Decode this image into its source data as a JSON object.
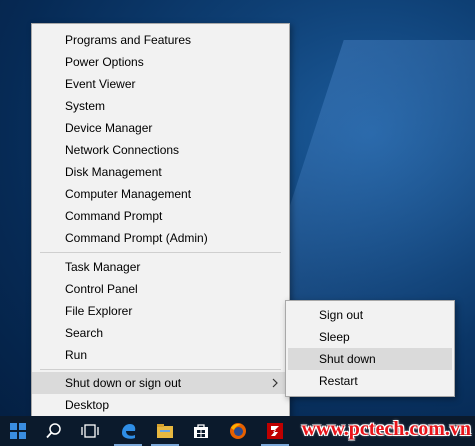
{
  "menu": {
    "group1": [
      "Programs and Features",
      "Power Options",
      "Event Viewer",
      "System",
      "Device Manager",
      "Network Connections",
      "Disk Management",
      "Computer Management",
      "Command Prompt",
      "Command Prompt (Admin)"
    ],
    "group2": [
      "Task Manager",
      "Control Panel",
      "File Explorer",
      "Search",
      "Run"
    ],
    "shutdown": "Shut down or sign out",
    "desktop": "Desktop"
  },
  "submenu": {
    "items": [
      "Sign out",
      "Sleep",
      "Shut down",
      "Restart"
    ]
  },
  "watermark": "www.pctech.com.vn",
  "taskbar": {
    "icons": [
      "windows-start-icon",
      "search-icon",
      "task-view-icon",
      "edge-browser-icon",
      "file-explorer-icon",
      "store-icon",
      "firefox-icon",
      "filezilla-icon"
    ]
  },
  "colors": {
    "accent": "#0e3f74",
    "menu_bg": "#f2f2f2",
    "hover": "#dadada",
    "watermark": "#e8141a"
  }
}
